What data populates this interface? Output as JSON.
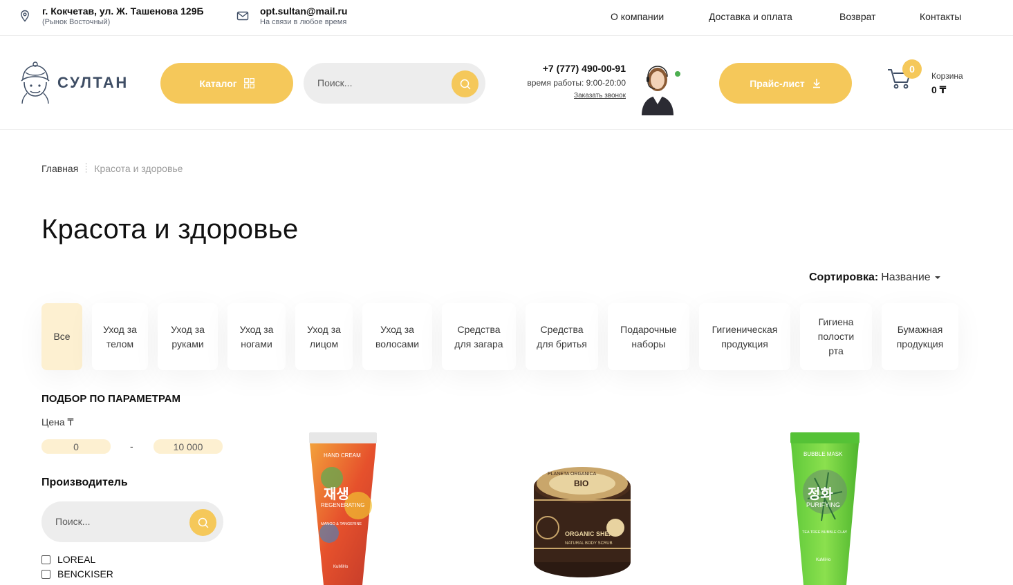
{
  "topbar": {
    "address": "г. Кокчетав, ул. Ж. Ташенова 129Б",
    "address_sub": "(Рынок Восточный)",
    "email": "opt.sultan@mail.ru",
    "email_sub": "На связи в любое время",
    "nav": [
      "О компании",
      "Доставка и оплата",
      "Возврат",
      "Контакты"
    ]
  },
  "header": {
    "logo_text": "СУЛТАН",
    "catalog_label": "Каталог",
    "search_placeholder": "Поиск...",
    "phone": "+7 (777) 490-00-91",
    "hours": "время работы: 9:00-20:00",
    "callback": "Заказать звонок",
    "pricelist_label": "Прайс-лист",
    "cart_count": "0",
    "cart_label": "Корзина",
    "cart_total": "0 ₸"
  },
  "breadcrumb": {
    "home": "Главная",
    "current": "Красота и здоровье"
  },
  "page_title": "Красота и здоровье",
  "sort": {
    "label": "Сортировка:",
    "value": "Название"
  },
  "categories": [
    "Все",
    "Уход за телом",
    "Уход за руками",
    "Уход за ногами",
    "Уход за лицом",
    "Уход за волосами",
    "Средства для загара",
    "Средства для бритья",
    "Подарочные наборы",
    "Гигиеническая продукция",
    "Гигиена полости рта",
    "Бумажная продукция"
  ],
  "filters": {
    "title": "ПОДБОР ПО ПАРАМЕТРАМ",
    "price_label": "Цена ₸",
    "price_min": "0",
    "price_dash": "-",
    "price_max": "10 000",
    "maker_title": "Производитель",
    "maker_search_placeholder": "Поиск...",
    "brands": [
      "LOREAL",
      "BENCKISER"
    ]
  },
  "products": [
    {
      "image": "hand-cream-tube",
      "text_main": "재생",
      "text_sub": "REGENERATING",
      "label_top": "HAND CREAM",
      "label_bottom": "MANGO & TANGERINE",
      "brand": "KuMiHo"
    },
    {
      "image": "body-scrub-jar",
      "text_main": "ORGANIC SHEA",
      "text_sub": "NATURAL BODY SCRUB",
      "label_top": "PLANETA ORGANICA",
      "badge": "BIO"
    },
    {
      "image": "bubble-mask-tube",
      "text_main": "정화",
      "text_sub": "PURIFYING",
      "label_top": "BUBBLE MASK",
      "label_bottom": "TEA TREE BUBBLE CLAY",
      "brand": "KuMiHo"
    }
  ]
}
